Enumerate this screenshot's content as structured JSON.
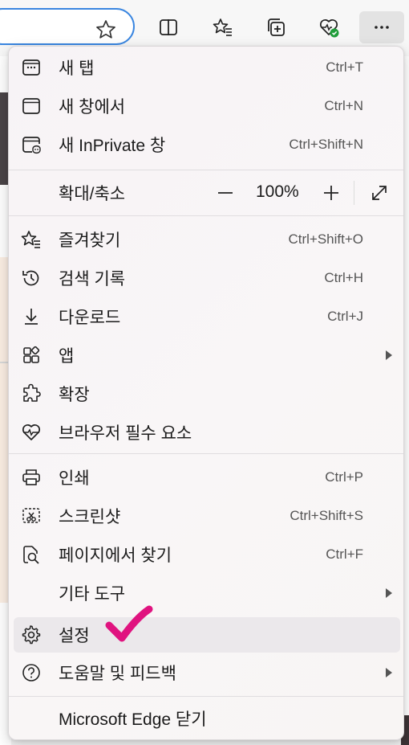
{
  "toolbar": {
    "buttons": [
      {
        "name": "split-screen-icon"
      },
      {
        "name": "favorites-icon"
      },
      {
        "name": "collections-icon"
      },
      {
        "name": "browser-essentials-icon"
      },
      {
        "name": "more-options-icon"
      }
    ]
  },
  "menu": {
    "items": [
      {
        "label": "새 탭",
        "shortcut": "Ctrl+T",
        "icon": "new-tab-icon"
      },
      {
        "label": "새 창에서",
        "shortcut": "Ctrl+N",
        "icon": "new-window-icon"
      },
      {
        "label": "새 InPrivate 창",
        "shortcut": "Ctrl+Shift+N",
        "icon": "inprivate-icon"
      },
      {
        "label": "즐겨찾기",
        "shortcut": "Ctrl+Shift+O",
        "icon": "favorites-icon"
      },
      {
        "label": "검색 기록",
        "shortcut": "Ctrl+H",
        "icon": "history-icon"
      },
      {
        "label": "다운로드",
        "shortcut": "Ctrl+J",
        "icon": "download-icon"
      },
      {
        "label": "앱",
        "shortcut": "",
        "icon": "apps-icon"
      },
      {
        "label": "확장",
        "shortcut": "",
        "icon": "extensions-icon"
      },
      {
        "label": "브라우저 필수 요소",
        "shortcut": "",
        "icon": "browser-essentials-icon"
      },
      {
        "label": "인쇄",
        "shortcut": "Ctrl+P",
        "icon": "print-icon"
      },
      {
        "label": "스크린샷",
        "shortcut": "Ctrl+Shift+S",
        "icon": "screenshot-icon"
      },
      {
        "label": "페이지에서 찾기",
        "shortcut": "Ctrl+F",
        "icon": "find-icon"
      },
      {
        "label": "기타 도구",
        "shortcut": "",
        "icon": ""
      },
      {
        "label": "설정",
        "shortcut": "",
        "icon": "settings-icon"
      },
      {
        "label": "도움말 및 피드백",
        "shortcut": "",
        "icon": "help-icon"
      },
      {
        "label": "Microsoft Edge 닫기",
        "shortcut": "",
        "icon": ""
      }
    ],
    "zoom": {
      "label": "확대/축소",
      "value": "100%"
    }
  },
  "colors": {
    "accent": "#3a86e0",
    "checkmark": "#e0137f",
    "badge_green": "#1f9d3a"
  }
}
